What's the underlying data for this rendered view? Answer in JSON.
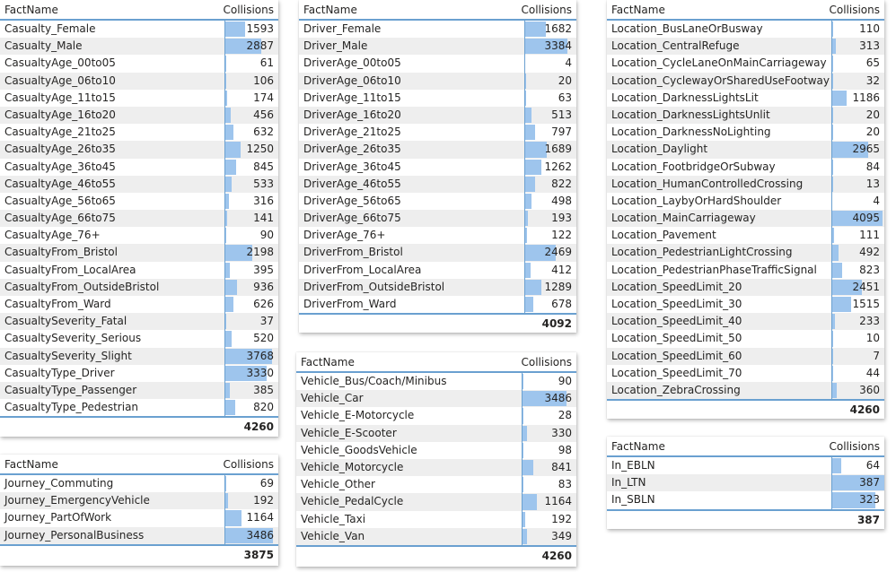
{
  "tables": [
    {
      "id": "casualty",
      "header": {
        "name": "FactName",
        "value": "Collisions"
      },
      "total": "4260",
      "max": 4260,
      "rows": [
        {
          "name": "Casualty_Female",
          "value": 1593
        },
        {
          "name": "Casualty_Male",
          "value": 2887
        },
        {
          "name": "CasualtyAge_00to05",
          "value": 61
        },
        {
          "name": "CasualtyAge_06to10",
          "value": 106
        },
        {
          "name": "CasualtyAge_11to15",
          "value": 174
        },
        {
          "name": "CasualtyAge_16to20",
          "value": 456
        },
        {
          "name": "CasualtyAge_21to25",
          "value": 632
        },
        {
          "name": "CasualtyAge_26to35",
          "value": 1250
        },
        {
          "name": "CasualtyAge_36to45",
          "value": 845
        },
        {
          "name": "CasualtyAge_46to55",
          "value": 533
        },
        {
          "name": "CasualtyAge_56to65",
          "value": 316
        },
        {
          "name": "CasualtyAge_66to75",
          "value": 141
        },
        {
          "name": "CasualtyAge_76+",
          "value": 90
        },
        {
          "name": "CasualtyFrom_Bristol",
          "value": 2198
        },
        {
          "name": "CasualtyFrom_LocalArea",
          "value": 395
        },
        {
          "name": "CasualtyFrom_OutsideBristol",
          "value": 936
        },
        {
          "name": "CasualtyFrom_Ward",
          "value": 626
        },
        {
          "name": "CasualtySeverity_Fatal",
          "value": 37
        },
        {
          "name": "CasualtySeverity_Serious",
          "value": 520
        },
        {
          "name": "CasualtySeverity_Slight",
          "value": 3768
        },
        {
          "name": "CasualtyType_Driver",
          "value": 3330
        },
        {
          "name": "CasualtyType_Passenger",
          "value": 385
        },
        {
          "name": "CasualtyType_Pedestrian",
          "value": 820
        }
      ]
    },
    {
      "id": "journey",
      "header": {
        "name": "FactName",
        "value": "Collisions"
      },
      "total": "3875",
      "max": 3875,
      "rows": [
        {
          "name": "Journey_Commuting",
          "value": 69
        },
        {
          "name": "Journey_EmergencyVehicle",
          "value": 192
        },
        {
          "name": "Journey_PartOfWork",
          "value": 1164
        },
        {
          "name": "Journey_PersonalBusiness",
          "value": 3486
        }
      ]
    },
    {
      "id": "driver",
      "header": {
        "name": "FactName",
        "value": "Collisions"
      },
      "total": "4092",
      "max": 4092,
      "rows": [
        {
          "name": "Driver_Female",
          "value": 1682
        },
        {
          "name": "Driver_Male",
          "value": 3384
        },
        {
          "name": "DriverAge_00to05",
          "value": 4
        },
        {
          "name": "DriverAge_06to10",
          "value": 20
        },
        {
          "name": "DriverAge_11to15",
          "value": 63
        },
        {
          "name": "DriverAge_16to20",
          "value": 513
        },
        {
          "name": "DriverAge_21to25",
          "value": 797
        },
        {
          "name": "DriverAge_26to35",
          "value": 1689
        },
        {
          "name": "DriverAge_36to45",
          "value": 1262
        },
        {
          "name": "DriverAge_46to55",
          "value": 822
        },
        {
          "name": "DriverAge_56to65",
          "value": 498
        },
        {
          "name": "DriverAge_66to75",
          "value": 193
        },
        {
          "name": "DriverAge_76+",
          "value": 122
        },
        {
          "name": "DriverFrom_Bristol",
          "value": 2469
        },
        {
          "name": "DriverFrom_LocalArea",
          "value": 412
        },
        {
          "name": "DriverFrom_OutsideBristol",
          "value": 1289
        },
        {
          "name": "DriverFrom_Ward",
          "value": 678
        }
      ]
    },
    {
      "id": "vehicle",
      "header": {
        "name": "FactName",
        "value": "Collisions"
      },
      "total": "4260",
      "max": 4260,
      "rows": [
        {
          "name": "Vehicle_Bus/Coach/Minibus",
          "value": 90
        },
        {
          "name": "Vehicle_Car",
          "value": 3486
        },
        {
          "name": "Vehicle_E-Motorcycle",
          "value": 28
        },
        {
          "name": "Vehicle_E-Scooter",
          "value": 330
        },
        {
          "name": "Vehicle_GoodsVehicle",
          "value": 98
        },
        {
          "name": "Vehicle_Motorcycle",
          "value": 841
        },
        {
          "name": "Vehicle_Other",
          "value": 83
        },
        {
          "name": "Vehicle_PedalCycle",
          "value": 1164
        },
        {
          "name": "Vehicle_Taxi",
          "value": 192
        },
        {
          "name": "Vehicle_Van",
          "value": 349
        }
      ]
    },
    {
      "id": "location",
      "header": {
        "name": "FactName",
        "value": "Collisions"
      },
      "total": "4260",
      "max": 4260,
      "rows": [
        {
          "name": "Location_BusLaneOrBusway",
          "value": 110
        },
        {
          "name": "Location_CentralRefuge",
          "value": 313
        },
        {
          "name": "Location_CycleLaneOnMainCarriageway",
          "value": 65
        },
        {
          "name": "Location_CyclewayOrSharedUseFootway",
          "value": 32
        },
        {
          "name": "Location_DarknessLightsLit",
          "value": 1186
        },
        {
          "name": "Location_DarknessLightsUnlit",
          "value": 20
        },
        {
          "name": "Location_DarknessNoLighting",
          "value": 20
        },
        {
          "name": "Location_Daylight",
          "value": 2965
        },
        {
          "name": "Location_FootbridgeOrSubway",
          "value": 84
        },
        {
          "name": "Location_HumanControlledCrossing",
          "value": 13
        },
        {
          "name": "Location_LaybyOrHardShoulder",
          "value": 4
        },
        {
          "name": "Location_MainCarriageway",
          "value": 4095
        },
        {
          "name": "Location_Pavement",
          "value": 111
        },
        {
          "name": "Location_PedestrianLightCrossing",
          "value": 492
        },
        {
          "name": "Location_PedestrianPhaseTrafficSignal",
          "value": 823
        },
        {
          "name": "Location_SpeedLimit_20",
          "value": 2451
        },
        {
          "name": "Location_SpeedLimit_30",
          "value": 1515
        },
        {
          "name": "Location_SpeedLimit_40",
          "value": 233
        },
        {
          "name": "Location_SpeedLimit_50",
          "value": 10
        },
        {
          "name": "Location_SpeedLimit_60",
          "value": 7
        },
        {
          "name": "Location_SpeedLimit_70",
          "value": 44
        },
        {
          "name": "Location_ZebraCrossing",
          "value": 360
        }
      ]
    },
    {
      "id": "in",
      "header": {
        "name": "FactName",
        "value": "Collisions"
      },
      "total": "387",
      "max": 387,
      "rows": [
        {
          "name": "In_EBLN",
          "value": 64
        },
        {
          "name": "In_LTN",
          "value": 387
        },
        {
          "name": "In_SBLN",
          "value": 323
        }
      ]
    }
  ],
  "colors": {
    "bar": "#9ec5ed",
    "rule": "#6aa0d0",
    "alt_row": "#eeeeee"
  }
}
